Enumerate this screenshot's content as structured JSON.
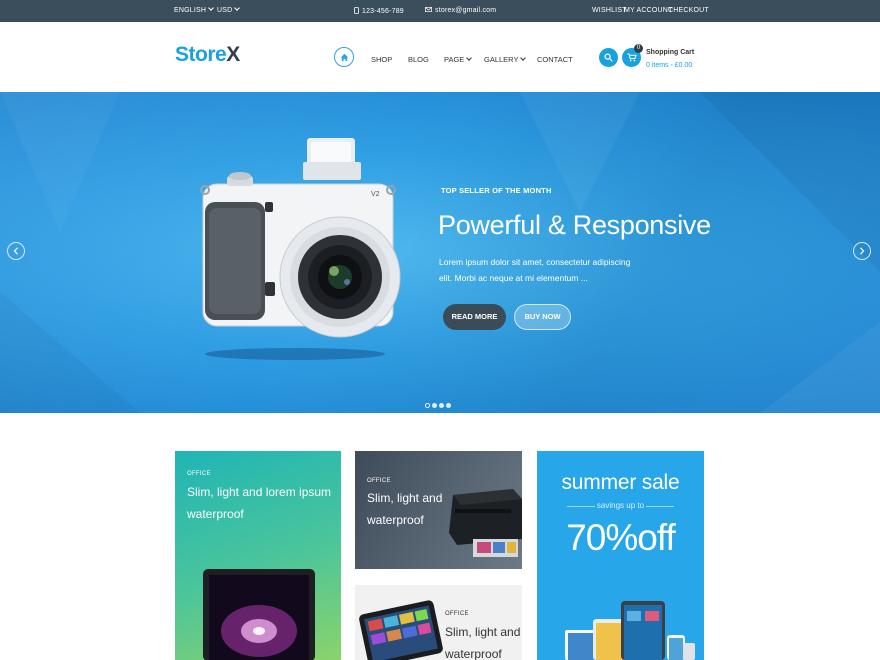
{
  "topbar": {
    "language": "ENGLISH",
    "currency": "USD",
    "phone": "123-456-789",
    "email": "storex@gmail.com",
    "links": [
      "WISHLIST",
      "MY ACCOUNT",
      "CHECKOUT"
    ]
  },
  "header": {
    "logo_main": "Store",
    "logo_accent": "X",
    "nav": [
      "SHOP",
      "BLOG",
      "PAGE",
      "GALLERY",
      "CONTACT"
    ],
    "cart": {
      "count": "0",
      "title": "Shopping Cart",
      "summary": "0 items - £0.00"
    }
  },
  "hero": {
    "eyebrow": "TOP SELLER OF THE MONTH",
    "title": "Powerful & Responsive",
    "description": "Lorem ipsum dolor sit amet, consectetur adipiscing elit. Morbi ac neque at mi elementum ...",
    "read_more": "READ MORE",
    "buy_now": "BUY NOW",
    "slides": 4,
    "active_slide": 1
  },
  "banners": {
    "b1": {
      "category": "OFFICE",
      "title_line1": "Slim, light and lorem ipsum",
      "title_line2": "waterproof"
    },
    "b2": {
      "category": "OFFICE",
      "title_line1": "Slim, light and",
      "title_line2": "waterproof"
    },
    "b3": {
      "category": "OFFICE",
      "title_line1": "Slim, light and",
      "title_line2": "waterproof"
    },
    "sale": {
      "title": "summer sale",
      "subtitle": "savings up to",
      "amount": "70%off"
    }
  },
  "colors": {
    "brand": "#19a2dd",
    "topbar": "#3b4e5b",
    "hero_blue": "#2f9ee3",
    "sale_blue": "#27a7ea"
  }
}
